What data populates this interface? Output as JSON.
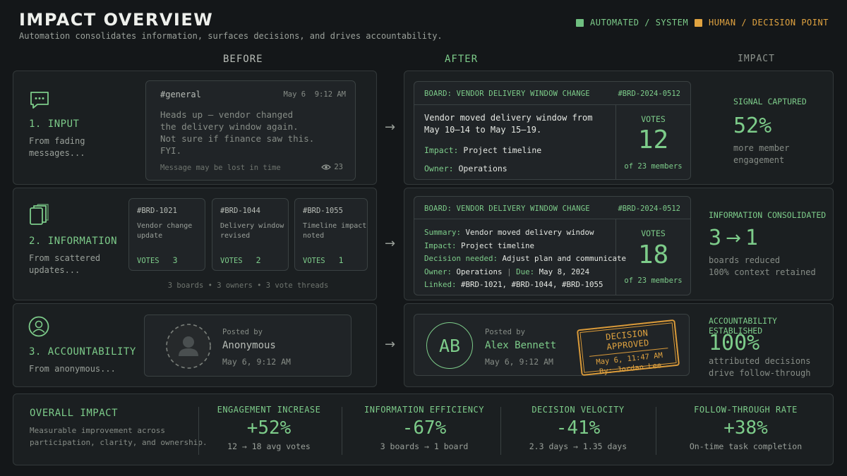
{
  "header": {
    "title": "IMPACT OVERVIEW",
    "subtitle": "Automation consolidates information, surfaces decisions, and drives accountability.",
    "legend": [
      {
        "label": "AUTOMATED / SYSTEM",
        "color": "#6fbf80"
      },
      {
        "label": "HUMAN / DECISION POINT",
        "color": "#e0a340"
      }
    ]
  },
  "columns": {
    "before": "BEFORE",
    "after": "AFTER",
    "impact": "IMPACT"
  },
  "rows": {
    "input": {
      "icon": "chat-bubble-icon",
      "title": "1. INPUT",
      "subtitle_1": "From fading",
      "subtitle_2": "messages...",
      "message": {
        "channel": "#general",
        "time": "May 6  9:12 AM",
        "line1": "Heads up — vendor changed",
        "line2": "the delivery window again.",
        "line3": "Not sure if finance saw this.",
        "line4": "FYI.",
        "footer": "Message may be lost in time",
        "views": "23"
      },
      "board": {
        "name": "BOARD: VENDOR DELIVERY WINDOW CHANGE",
        "id": "#BRD-2024-0512",
        "text1": "Vendor moved delivery window from",
        "text2": "May 10–14 to May 15–19.",
        "impact_label": "Impact:",
        "impact_value": "Project timeline",
        "owner_label": "Owner:",
        "owner_value": "Operations",
        "votes_label": "VOTES",
        "votes": "12",
        "votes_of": "of 23 members"
      },
      "impact": {
        "heading": "SIGNAL CAPTURED",
        "value": "52%",
        "desc1": "more member",
        "desc2": "engagement"
      }
    },
    "information": {
      "icon": "stacked-documents-icon",
      "title": "2. INFORMATION",
      "subtitle_1": "From scattered",
      "subtitle_2": "updates...",
      "cards": [
        {
          "id": "#BRD-1021",
          "line1": "Vendor change",
          "line2": "update",
          "votes_label": "VOTES",
          "votes": "3"
        },
        {
          "id": "#BRD-1044",
          "line1": "Delivery window",
          "line2": "revised",
          "votes_label": "VOTES",
          "votes": "2"
        },
        {
          "id": "#BRD-1055",
          "line1": "Timeline impact",
          "line2": "noted",
          "votes_label": "VOTES",
          "votes": "1"
        }
      ],
      "footer": "3 boards • 3 owners • 3 vote threads",
      "board": {
        "name": "BOARD: VENDOR DELIVERY WINDOW CHANGE",
        "id": "#BRD-2024-0512",
        "summary_label": "Summary:",
        "summary_value": "Vendor moved delivery window",
        "impact_label": "Impact:",
        "impact_value": "Project timeline",
        "decision_label": "Decision needed:",
        "decision_value": "Adjust plan and communicate",
        "owner_label": "Owner:",
        "owner_value": "Operations",
        "due_label": "Due:",
        "due_value": "May 8, 2024",
        "linked_label": "Linked:",
        "linked_value": "#BRD-1021, #BRD-1044, #BRD-1055",
        "votes_label": "VOTES",
        "votes": "18",
        "votes_of": "of 23 members"
      },
      "impact": {
        "heading": "INFORMATION CONSOLIDATED",
        "from": "3",
        "to": "1",
        "desc1": "boards reduced",
        "desc2": "100% context retained"
      }
    },
    "accountability": {
      "icon": "person-circle-icon",
      "title": "3. ACCOUNTABILITY",
      "subtitle_1": "From anonymous...",
      "before_post": {
        "posted_by": "Posted by",
        "name": "Anonymous",
        "time": "May 6, 9:12 AM"
      },
      "after_post": {
        "initials": "AB",
        "posted_by": "Posted by",
        "name": "Alex Bennett",
        "time": "May 6, 9:12 AM"
      },
      "stamp": {
        "title": "DECISION APPROVED",
        "time": "May 6, 11:47 AM",
        "by": "By: Jordan Lee"
      },
      "impact": {
        "heading": "ACCOUNTABILITY ESTABLISHED",
        "value": "100%",
        "desc1": "attributed decisions",
        "desc2": "drive follow-through"
      }
    }
  },
  "overall": {
    "title": "OVERALL IMPACT",
    "desc1": "Measurable improvement across",
    "desc2": "participation, clarity, and ownership.",
    "stats": [
      {
        "heading": "ENGAGEMENT INCREASE",
        "value": "+52%",
        "sub": "12 → 18 avg votes"
      },
      {
        "heading": "INFORMATION EFFICIENCY",
        "value": "-67%",
        "sub": "3 boards → 1 board"
      },
      {
        "heading": "DECISION VELOCITY",
        "value": "-41%",
        "sub": "2.3 days → 1.35 days"
      },
      {
        "heading": "FOLLOW-THROUGH RATE",
        "value": "+38%",
        "sub": "On-time task completion"
      }
    ]
  }
}
